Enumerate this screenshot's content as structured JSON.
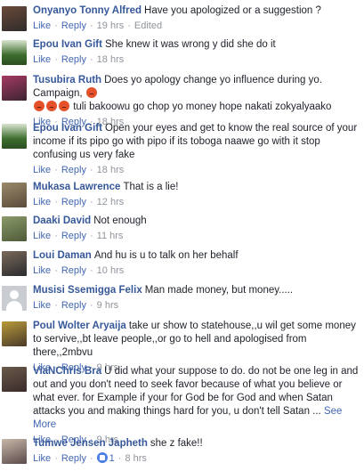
{
  "labels": {
    "like": "Like",
    "reply": "Reply",
    "see_more": "See More"
  },
  "comments": [
    {
      "author": "Onyanyo Tonny Alfred",
      "text": "Have you apologized or a suggestion ?",
      "time": "19 hrs",
      "edited": "Edited",
      "av1": "#6b4a3a",
      "av2": "#2f2b2a"
    },
    {
      "author": "Epou Ivan Gift",
      "text": "She knew it was wrong y did she do it",
      "time": "18 hrs",
      "av1": "#3d6e2e",
      "av2": "#d9e4cf"
    },
    {
      "author": "Tusubira Ruth",
      "text_a": "Does yo apology change yo influence during yo. Campaign,",
      "text_b": "tuli bakoowu go chop yo money hope nakati zokyalyaako",
      "time": "18 hrs",
      "av1": "#a53a62",
      "av2": "#3b2431"
    },
    {
      "author": "Epou Ivan Gift",
      "text": "Open your eyes and get to know the real source of your income if its pipo go with pipo if its toboga naawe go with it stop confusing us very fake",
      "time": "18 hrs",
      "av1": "#3d6e2e",
      "av2": "#d9e4cf"
    },
    {
      "author": "Mukasa Lawrence",
      "text": "That is a lie!",
      "time": "12 hrs",
      "av1": "#5a4a3a",
      "av2": "#9a8a6a"
    },
    {
      "author": "Daaki David",
      "text": "Not enough",
      "time": "11 hrs",
      "av1": "#4e5a38",
      "av2": "#8a9a6a"
    },
    {
      "author": "Loui Daman",
      "text": "And hu is u to talk on her behalf",
      "time": "10 hrs",
      "av1": "#2a2a2e",
      "av2": "#7a6a5a"
    },
    {
      "author": "Musisi Ssemigga Felix",
      "text": "Man made money, but money.....",
      "time": "9 hrs"
    },
    {
      "author": "Poul Wolter Aryaija",
      "text": "take ur show to statehouse,,u wil get some money to servive,,bt leave people,,or go to hell and apologised from there,,2mbvu",
      "time": "9 hrs",
      "av1": "#b89a3a",
      "av2": "#4a3a2a"
    },
    {
      "author": "ViaNChris Bra",
      "text": "U did what your suppose to do. do not be one leg in and out and you don't need to seek favor because of what you believe or what ever. for Example if your for God be for God and when Satan attacks you and making things hard for you, u don't tell Satan ...",
      "time": "9 hrs",
      "av1": "#3a2a2a",
      "av2": "#6a5a4a"
    },
    {
      "author": "Tumwe Jensen Japheth",
      "text": "she z fake!!",
      "likes": "1",
      "time": "8 hrs",
      "av1": "#5a4a4a",
      "av2": "#c9b8a8"
    }
  ]
}
